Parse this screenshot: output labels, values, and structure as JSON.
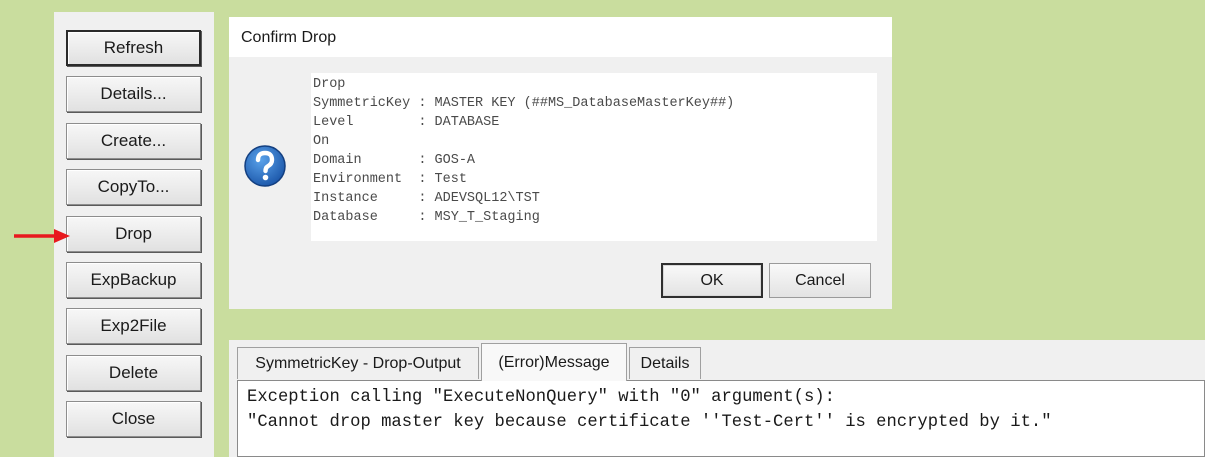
{
  "sidebar": {
    "buttons": [
      {
        "label": "Refresh"
      },
      {
        "label": "Details..."
      },
      {
        "label": "Create..."
      },
      {
        "label": "CopyTo..."
      },
      {
        "label": "Drop"
      },
      {
        "label": "ExpBackup"
      },
      {
        "label": "Exp2File"
      },
      {
        "label": "Delete"
      },
      {
        "label": "Close"
      }
    ]
  },
  "annotation": {
    "arrow_color": "#e8191e"
  },
  "dialog": {
    "title": "Confirm Drop",
    "icon": "question-icon",
    "message_lines": [
      "Drop",
      "SymmetricKey : MASTER KEY (##MS_DatabaseMasterKey##)",
      "Level        : DATABASE",
      "On",
      "Domain       : GOS-A",
      "Environment  : Test",
      "Instance     : ADEVSQL12\\TST",
      "Database     : MSY_T_Staging"
    ],
    "ok_label": "OK",
    "cancel_label": "Cancel"
  },
  "output": {
    "tabs": [
      {
        "label": "SymmetricKey - Drop-Output"
      },
      {
        "label": "(Error)Message",
        "active": true
      },
      {
        "label": "Details"
      }
    ],
    "error_lines": [
      "Exception calling \"ExecuteNonQuery\" with \"0\" argument(s):",
      "\"Cannot drop master key because certificate ''Test-Cert'' is encrypted by it.\""
    ]
  },
  "colors": {
    "background": "#c9dd9e",
    "panel": "#f0f0f0",
    "icon_blue": "#1f64b8"
  }
}
